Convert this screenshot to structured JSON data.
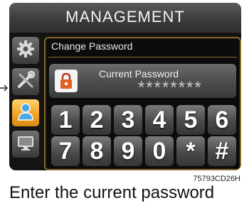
{
  "header": {
    "title": "MANAGEMENT"
  },
  "sidebar": {
    "items": [
      {
        "icon": "gear-icon",
        "active": false
      },
      {
        "icon": "tools-icon",
        "active": false
      },
      {
        "icon": "user-icon",
        "active": true
      },
      {
        "icon": "monitor-icon",
        "active": false
      }
    ]
  },
  "panel": {
    "title": "Change Password",
    "current_password": {
      "label": "Current Password",
      "value": "********"
    },
    "keypad": [
      "1",
      "2",
      "3",
      "4",
      "5",
      "6",
      "7",
      "8",
      "9",
      "0",
      "*",
      "#"
    ]
  },
  "figure_code": "75793CD26H",
  "below_text": "Enter the current password",
  "colors": {
    "accent": "#f0a020",
    "panel_border": "#8a6a2a"
  }
}
